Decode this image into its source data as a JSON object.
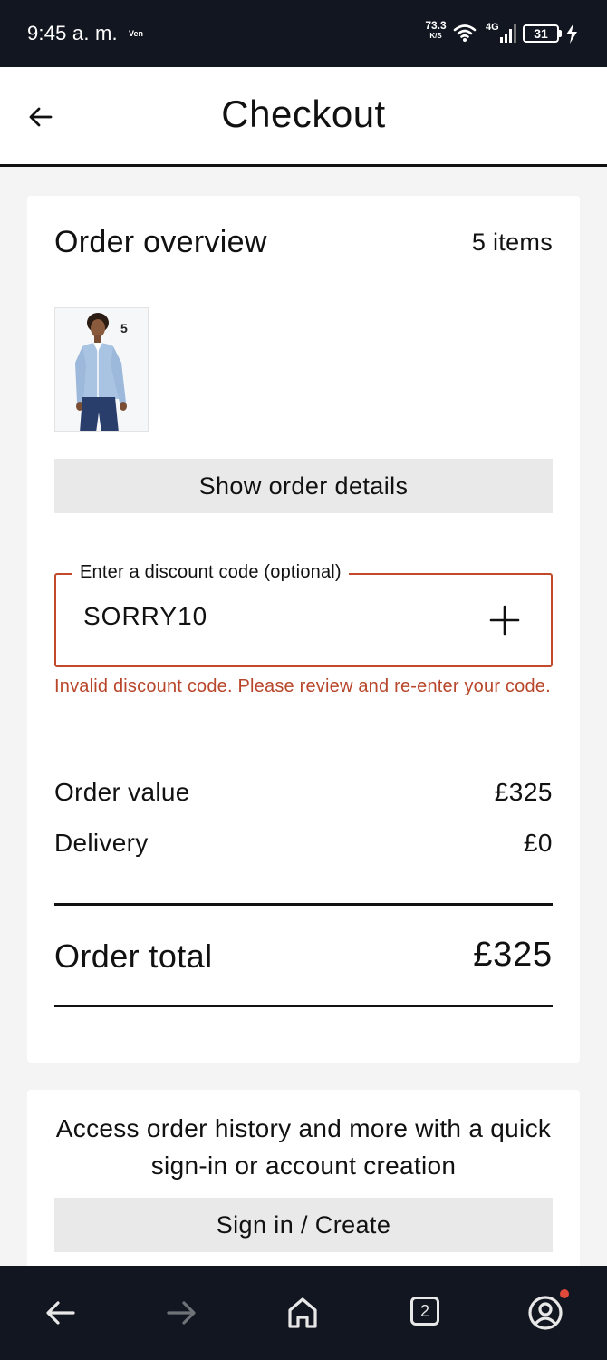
{
  "status_bar": {
    "time": "9:45 a. m.",
    "carrier": "Ven",
    "speed": "73.3",
    "speed_unit": "K/S",
    "network": "4G",
    "battery": "31"
  },
  "header": {
    "title": "Checkout"
  },
  "overview": {
    "title": "Order overview",
    "item_count": "5 items",
    "product_quantity": "5",
    "show_details_label": "Show order details"
  },
  "discount": {
    "legend": "Enter a discount code (optional)",
    "value": "SORRY10",
    "error": "Invalid discount code. Please review and re-enter your code."
  },
  "summary": {
    "order_value_label": "Order value",
    "order_value": "£325",
    "delivery_label": "Delivery",
    "delivery_value": "£0",
    "total_label": "Order total",
    "total_value": "£325"
  },
  "signin": {
    "text": "Access order history and more with a quick sign-in or account creation",
    "button_label": "Sign in / Create"
  },
  "bottom_nav": {
    "tab_count": "2",
    "icons": [
      "back-arrow-icon",
      "forward-arrow-icon",
      "home-icon",
      "tabs-icon",
      "account-icon"
    ]
  },
  "colors": {
    "error": "#c24a2a",
    "button_grey": "#e9e9e9",
    "system_bar": "#121620"
  }
}
